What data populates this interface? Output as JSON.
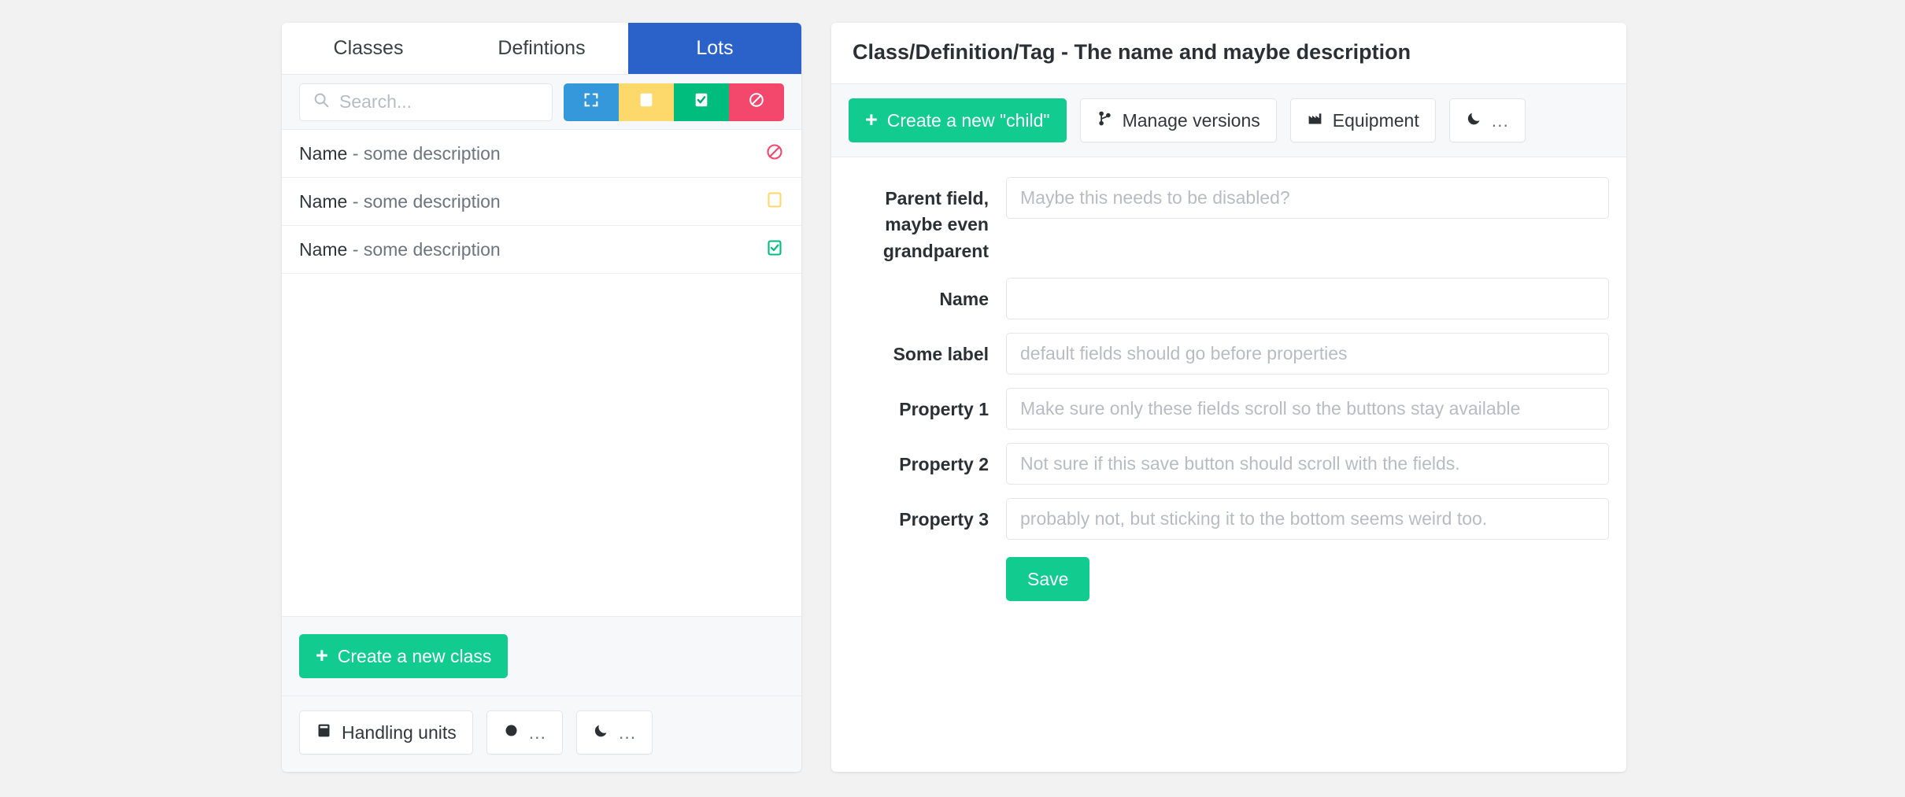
{
  "colors": {
    "tab_active_bg": "#2b62c9",
    "green": "#11cc8e",
    "filter_blue": "#3498db",
    "filter_yellow": "#fcd96a",
    "filter_green": "#00bd7e",
    "filter_red": "#f4476c",
    "status_red": "#f4476c",
    "status_yellow": "#fcd96a",
    "status_green": "#00bd7e",
    "page_bg": "#f2f2f2"
  },
  "left_panel": {
    "tabs": [
      {
        "label": "Classes",
        "active": false
      },
      {
        "label": "Defintions",
        "active": false
      },
      {
        "label": "Lots",
        "active": true
      }
    ],
    "search": {
      "placeholder": "Search...",
      "value": "",
      "icon": "search-icon"
    },
    "filters": [
      {
        "name": "expand-filter",
        "icon": "expand-icon",
        "color": "#3498db"
      },
      {
        "name": "pending-filter",
        "icon": "square-filled-icon",
        "color": "#fcd96a"
      },
      {
        "name": "approved-filter",
        "icon": "square-check-icon",
        "color": "#00bd7e"
      },
      {
        "name": "blocked-filter",
        "icon": "ban-icon",
        "color": "#f4476c"
      }
    ],
    "list": [
      {
        "name": "Name",
        "separator": " - ",
        "description": "some description",
        "status": "blocked",
        "status_icon": "ban-icon"
      },
      {
        "name": "Name",
        "separator": " - ",
        "description": "some description",
        "status": "pending",
        "status_icon": "square-empty-icon"
      },
      {
        "name": "Name",
        "separator": " - ",
        "description": "some description",
        "status": "approved",
        "status_icon": "square-check-icon"
      }
    ],
    "create_button": {
      "label": "Create a new class",
      "icon": "plus-icon"
    },
    "footer_buttons": [
      {
        "label": "Handling units",
        "icon": "box-icon"
      },
      {
        "label": "...",
        "icon": "circle-icon"
      },
      {
        "label": "...",
        "icon": "moon-icon"
      }
    ]
  },
  "right_panel": {
    "title": "Class/Definition/Tag - The name and maybe description",
    "toolbar": [
      {
        "label": "Create a new \"child\"",
        "icon": "plus-icon",
        "style": "green"
      },
      {
        "label": "Manage versions",
        "icon": "code-branch-icon",
        "style": "white"
      },
      {
        "label": "Equipment",
        "icon": "factory-icon",
        "style": "white"
      },
      {
        "label": "...",
        "icon": "moon-icon",
        "style": "white"
      }
    ],
    "fields": [
      {
        "label": "Parent field, maybe even grandparent",
        "placeholder": "Maybe this needs to be disabled?",
        "value": "",
        "multiline_label": true
      },
      {
        "label": "Name",
        "placeholder": "",
        "value": ""
      },
      {
        "label": "Some label",
        "placeholder": "default fields should go before properties",
        "value": ""
      },
      {
        "label": "Property 1",
        "placeholder": "Make sure only these fields scroll so the buttons stay available",
        "value": ""
      },
      {
        "label": "Property 2",
        "placeholder": "Not sure if this save button should scroll with the fields.",
        "value": ""
      },
      {
        "label": "Property 3",
        "placeholder": "probably not, but sticking it to the bottom seems weird too.",
        "value": ""
      }
    ],
    "save_button": {
      "label": "Save"
    }
  }
}
